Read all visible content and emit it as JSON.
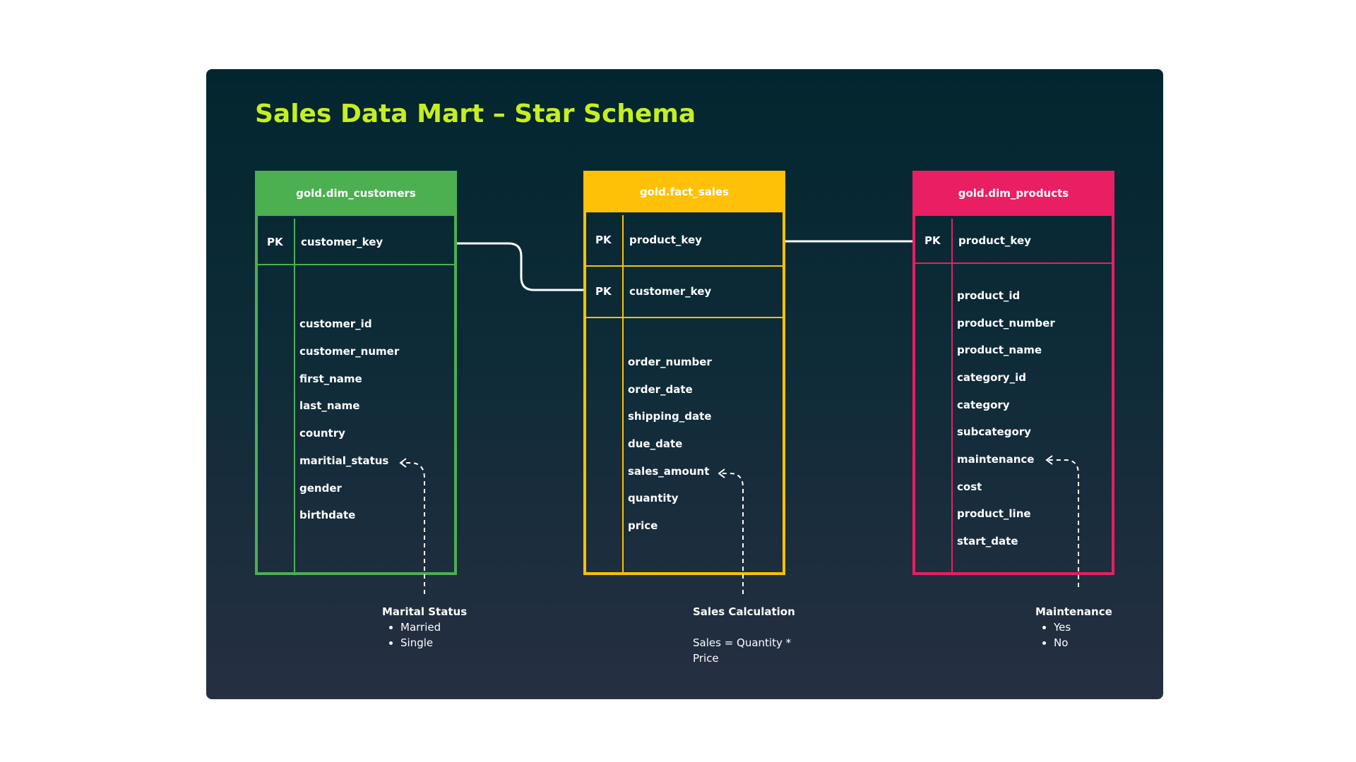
{
  "title": "Sales Data Mart – Star Schema",
  "colors": {
    "title": "#c6ef1f",
    "customers": "#4caf50",
    "sales": "#ffc107",
    "products": "#e91e63",
    "link": "#ffffff"
  },
  "tables": {
    "customers": {
      "name": "gold.dim_customers",
      "keys": [
        {
          "tag": "PK",
          "field": "customer_key"
        }
      ],
      "fields": [
        "customer_id",
        "customer_numer",
        "first_name",
        "last_name",
        "country",
        "maritial_status",
        "gender",
        "birthdate"
      ]
    },
    "sales": {
      "name": "gold.fact_sales",
      "keys": [
        {
          "tag": "PK",
          "field": "product_key"
        },
        {
          "tag": "PK",
          "field": "customer_key"
        }
      ],
      "fields": [
        "order_number",
        "order_date",
        "shipping_date",
        "due_date",
        "sales_amount",
        "quantity",
        "price"
      ]
    },
    "products": {
      "name": "gold.dim_products",
      "keys": [
        {
          "tag": "PK",
          "field": "product_key"
        }
      ],
      "fields": [
        "product_id",
        "product_number",
        "product_name",
        "category_id",
        "category",
        "subcategory",
        "maintenance",
        "cost",
        "product_line",
        "start_date"
      ]
    }
  },
  "notes": {
    "marital": {
      "heading": "Marital Status",
      "items": [
        "Married",
        "Single"
      ]
    },
    "sales": {
      "heading": "Sales Calculation",
      "text": "Sales = Quantity * Price"
    },
    "maintenance": {
      "heading": "Maintenance",
      "items": [
        "Yes",
        "No"
      ]
    }
  }
}
